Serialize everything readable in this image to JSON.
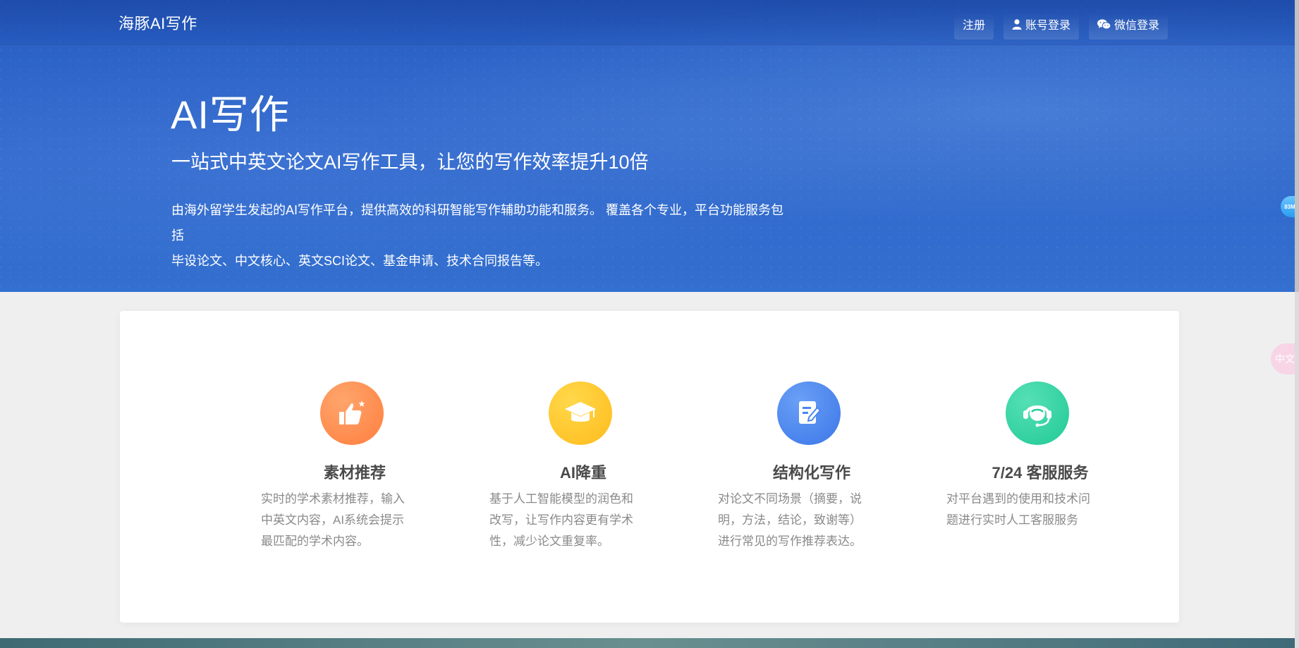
{
  "nav": {
    "brand": "海豚AI写作",
    "links": [
      {
        "label": "注册",
        "icon": ""
      },
      {
        "label": "账号登录",
        "icon": "user-icon"
      },
      {
        "label": "微信登录",
        "icon": "wechat-icon"
      }
    ]
  },
  "hero": {
    "title": "AI写作",
    "subtitle": "一站式中英文论文AI写作工具，让您的写作效率提升10倍",
    "desc_line1": "由海外留学生发起的AI写作平台，提供高效的科研智能写作辅助功能和服务。 覆盖各个专业，平台功能服务包括",
    "desc_line2": "毕设论文、中文核心、英文SCI论文、基金申请、技术合同报告等。"
  },
  "side": {
    "badge_text": "83M",
    "translate_text": "中文"
  },
  "features": [
    {
      "title": "素材推荐",
      "desc": "实时的学术素材推荐，输入中英文内容，AI系统会提示最匹配的学术内容。",
      "icon": "thumbs-up-icon",
      "color": "#ff8a4c"
    },
    {
      "title": "AI降重",
      "desc": "基于人工智能模型的润色和改写，让写作内容更有学术性，减少论文重复率。",
      "icon": "graduation-cap-icon",
      "color": "#ffc42a"
    },
    {
      "title": "结构化写作",
      "desc": "对论文不同场景（摘要，说明，方法，结论，致谢等）进行常见的写作推荐表达。",
      "icon": "document-edit-icon",
      "color": "#4b86f0"
    },
    {
      "title": "7/24 客服服务",
      "desc": "对平台遇到的使用和技术问题进行实时人工客服服务",
      "icon": "headset-icon",
      "color": "#2ed3a0"
    }
  ]
}
